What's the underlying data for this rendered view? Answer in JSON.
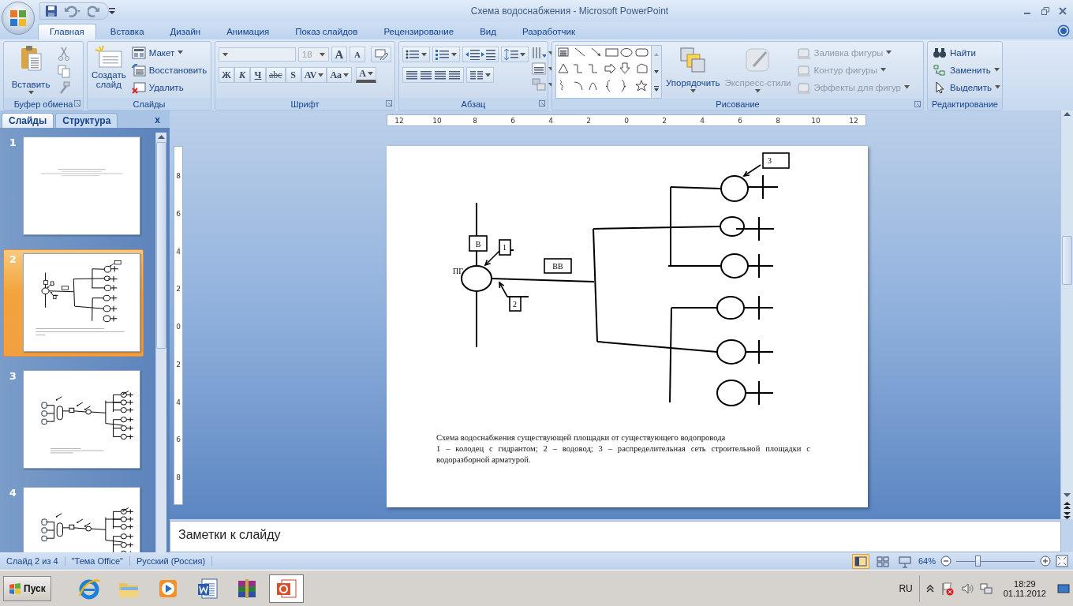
{
  "window": {
    "title": "Схема водоснабжения - Microsoft PowerPoint"
  },
  "tabs": [
    {
      "label": "Главная",
      "selected": true
    },
    {
      "label": "Вставка",
      "selected": false
    },
    {
      "label": "Дизайн",
      "selected": false
    },
    {
      "label": "Анимация",
      "selected": false
    },
    {
      "label": "Показ слайдов",
      "selected": false
    },
    {
      "label": "Рецензирование",
      "selected": false
    },
    {
      "label": "Вид",
      "selected": false
    },
    {
      "label": "Разработчик",
      "selected": false
    }
  ],
  "ribbon": {
    "clipboard": {
      "paste": "Вставить",
      "label": "Буфер обмена"
    },
    "slides": {
      "new_slide": "Создать слайд",
      "layout": "Макет",
      "reset": "Восстановить",
      "delete": "Удалить",
      "label": "Слайды"
    },
    "font": {
      "size": "18",
      "disabled": true,
      "grow": "A",
      "shrink": "A",
      "buttons": [
        "Ж",
        "К",
        "Ч",
        "abc",
        "S",
        "AV",
        "Aa"
      ],
      "color_button": "A",
      "label": "Шрифт"
    },
    "paragraph": {
      "label": "Абзац"
    },
    "drawing": {
      "arrange": "Упорядочить",
      "quick_styles": {
        "label": "Экспресс-стили",
        "disabled": true
      },
      "items": [
        {
          "label": "Заливка фигуры",
          "disabled": true
        },
        {
          "label": "Контур фигуры",
          "disabled": true
        },
        {
          "label": "Эффекты для фигур",
          "disabled": true
        }
      ],
      "label": "Рисование"
    },
    "editing": {
      "items": [
        {
          "label": "Найти",
          "kind": "find"
        },
        {
          "label": "Заменить",
          "kind": "replace"
        },
        {
          "label": "Выделить",
          "kind": "select"
        }
      ],
      "label": "Редактирование"
    }
  },
  "panel": {
    "tabs": [
      {
        "label": "Слайды",
        "selected": true
      },
      {
        "label": "Структура",
        "selected": false
      }
    ],
    "close": "x",
    "thumbnails": [
      {
        "number": "1",
        "selected": false,
        "kind": "title"
      },
      {
        "number": "2",
        "selected": true,
        "kind": "network"
      },
      {
        "number": "3",
        "selected": false,
        "kind": "treatment"
      },
      {
        "number": "4",
        "selected": false,
        "kind": "treatment"
      }
    ]
  },
  "ruler": {
    "horizontal": [
      "12",
      "10",
      "8",
      "6",
      "4",
      "2",
      "0",
      "2",
      "4",
      "6",
      "8",
      "10",
      "12"
    ],
    "vertical": [
      "8",
      "6",
      "4",
      "2",
      "0",
      "2",
      "4",
      "6",
      "8"
    ]
  },
  "slide": {
    "labels": [
      {
        "text": "В",
        "kind": "box"
      },
      {
        "text": "1",
        "kind": "callout"
      },
      {
        "text": "ПГ",
        "kind": "plain"
      },
      {
        "text": "2",
        "kind": "callout"
      },
      {
        "text": "ВВ",
        "kind": "box"
      },
      {
        "text": "3",
        "kind": "callout"
      }
    ],
    "caption": "Схема водоснабжения  существующей  площадки  от существующего  водопровода",
    "legend": "1 – колодец  с гидрантом;  2 – водовод; 3 – распределительная  сеть  строительной  площадки  с водоразборной  арматурой."
  },
  "notes": {
    "placeholder": "Заметки к слайду"
  },
  "status_bar": {
    "items": [
      "Слайд 2 из 4",
      "\"Тема Office\"",
      "Русский (Россия)"
    ],
    "zoom": "64%",
    "zoom_slider": {
      "level": 0.27
    },
    "views": [
      {
        "kind": "normal",
        "selected": true
      },
      {
        "kind": "sorter",
        "selected": false
      },
      {
        "kind": "show",
        "selected": false
      }
    ]
  },
  "taskbar": {
    "start": "Пуск",
    "apps": [
      {
        "kind": "browser",
        "selected": false
      },
      {
        "kind": "folder",
        "selected": false
      },
      {
        "kind": "media",
        "selected": false
      },
      {
        "kind": "word",
        "selected": false
      },
      {
        "kind": "archive",
        "selected": false
      },
      {
        "kind": "presentation",
        "selected": true
      }
    ],
    "language": "RU",
    "time": "18:29",
    "date": "01.11.2012"
  }
}
